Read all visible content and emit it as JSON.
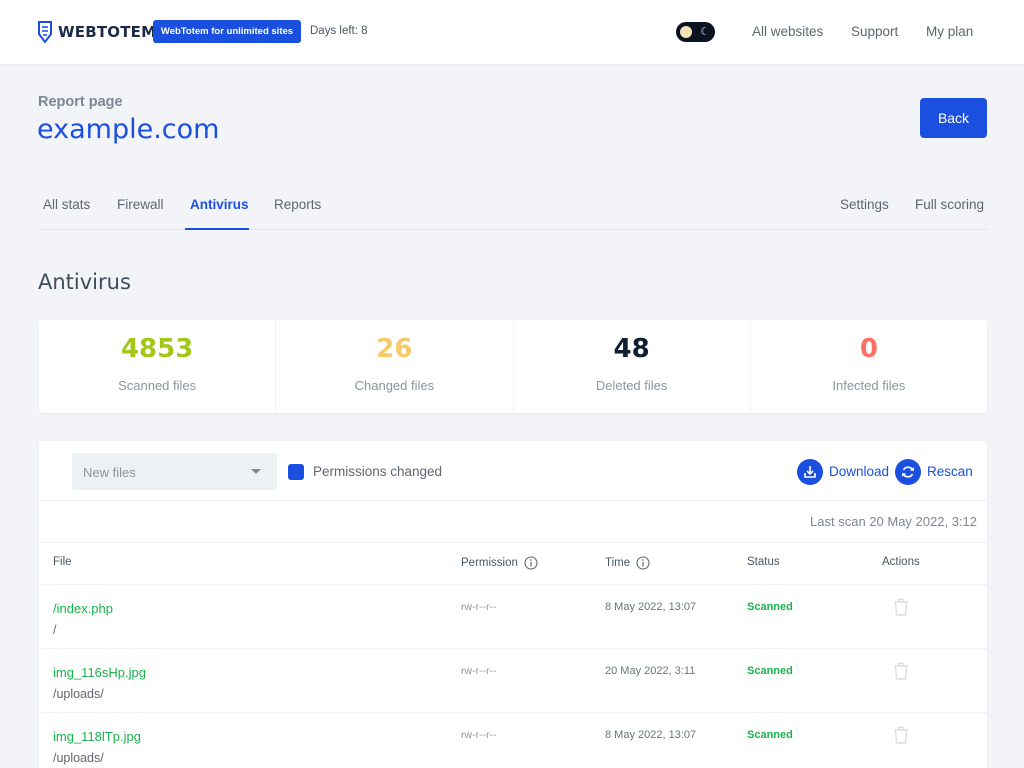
{
  "header": {
    "brand": "WEBTOTEM",
    "promo_badge": "WebTotem for unlimited sites",
    "days_left": "Days left: 8",
    "nav": [
      "All websites",
      "Support",
      "My plan"
    ]
  },
  "page": {
    "label": "Report page",
    "site": "example.com",
    "back_label": "Back"
  },
  "tabs": {
    "left": [
      "All stats",
      "Firewall",
      "Antivirus",
      "Reports"
    ],
    "right": [
      "Settings",
      "Full scoring"
    ],
    "active": "Antivirus"
  },
  "section_title": "Antivirus",
  "stats": [
    {
      "value": "4853",
      "label": "Scanned files",
      "color": "#a3c717"
    },
    {
      "value": "26",
      "label": "Changed files",
      "color": "#f6c96a"
    },
    {
      "value": "48",
      "label": "Deleted files",
      "color": "#0f1e33"
    },
    {
      "value": "0",
      "label": "Infected files",
      "color": "#ff6f61"
    }
  ],
  "toolbar": {
    "filter_value": "New files",
    "permissions_label": "Permissions changed",
    "download_label": "Download",
    "rescan_label": "Rescan",
    "last_scan": "Last scan 20 May 2022, 3:12"
  },
  "table": {
    "headers": {
      "file": "File",
      "permission": "Permission",
      "time": "Time",
      "status": "Status",
      "actions": "Actions"
    },
    "rows": [
      {
        "file": "/index.php",
        "path": "/",
        "permission": "rw-r--r--",
        "time": "8 May 2022, 13:07",
        "status": "Scanned"
      },
      {
        "file": "img_116sHp.jpg",
        "path": "/uploads/",
        "permission": "rw-r--r--",
        "time": "20 May 2022, 3:11",
        "status": "Scanned"
      },
      {
        "file": "img_118lTp.jpg",
        "path": "/uploads/",
        "permission": "rw-r--r--",
        "time": "8 May 2022, 13:07",
        "status": "Scanned"
      }
    ]
  },
  "colors": {
    "accent": "#1b4fe0",
    "success": "#1ab24b"
  }
}
